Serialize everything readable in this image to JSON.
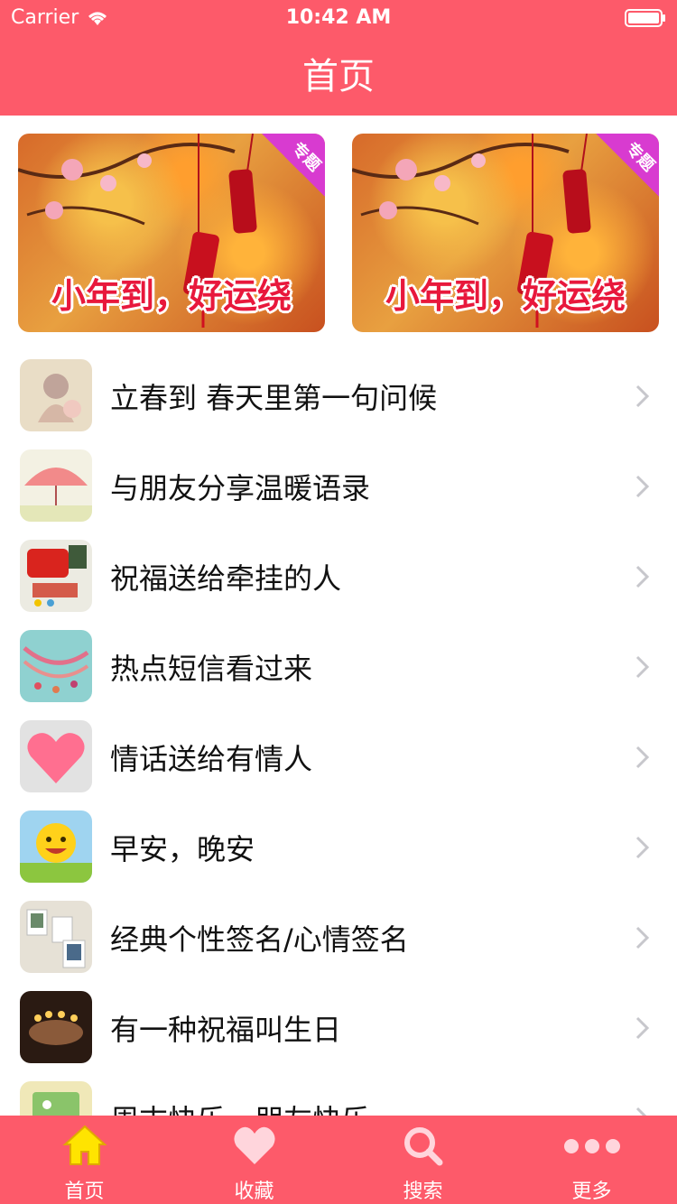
{
  "status_bar": {
    "carrier": "Carrier",
    "time": "10:42 AM"
  },
  "nav": {
    "title": "首页"
  },
  "banners": [
    {
      "caption": "小年到，好运绕",
      "badge": "专题"
    },
    {
      "caption": "小年到，好运绕",
      "badge": "专题"
    }
  ],
  "list": {
    "items": [
      {
        "label": "立春到 春天里第一句问候",
        "icon": "spring-flower-thumb"
      },
      {
        "label": "与朋友分享温暖语录",
        "icon": "pink-umbrella-thumb"
      },
      {
        "label": "祝福送给牵挂的人",
        "icon": "mailbox-thumb"
      },
      {
        "label": "热点短信看过来",
        "icon": "beads-thumb"
      },
      {
        "label": "情话送给有情人",
        "icon": "heart-thumb"
      },
      {
        "label": "早安，晚安",
        "icon": "sun-thumb"
      },
      {
        "label": "经典个性签名/心情签名",
        "icon": "photos-thumb"
      },
      {
        "label": "有一种祝福叫生日",
        "icon": "birthday-candles-thumb"
      },
      {
        "label": "周末快乐，朋友快乐",
        "icon": "weekend-thumb"
      }
    ]
  },
  "tabbar": {
    "items": [
      {
        "label": "首页",
        "icon": "home-icon",
        "active": true
      },
      {
        "label": "收藏",
        "icon": "heart-icon"
      },
      {
        "label": "搜索",
        "icon": "search-icon"
      },
      {
        "label": "更多",
        "icon": "more-icon"
      }
    ]
  },
  "colors": {
    "brand": "#fd5a6a",
    "active_tab_icon": "#ffe400"
  }
}
